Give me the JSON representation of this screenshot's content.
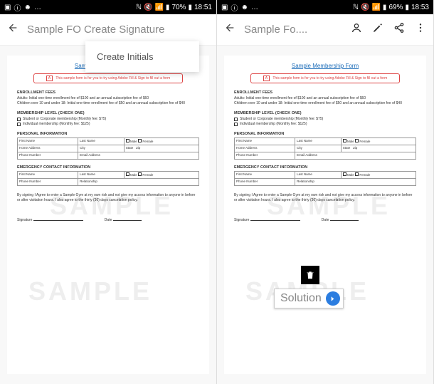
{
  "left": {
    "status": {
      "battery": "70%",
      "time": "18:51"
    },
    "app_title": "Sample FO Create Signature",
    "dropdown": {
      "item": "Create Initials"
    }
  },
  "right": {
    "status": {
      "battery": "69%",
      "time": "18:53"
    },
    "app_title": "Sample Fo....",
    "delete_label": "delete",
    "solution_label": "Solution"
  },
  "doc": {
    "title": "Sample Membership Form",
    "hint_badge": "A",
    "hint_text": "This sample form is for you to try using Adobe Fill & Sign to fill out a form",
    "enrollment_hdr": "ENROLLMENT FEES",
    "enrollment_line1": "Adults: Initial one-time enrollment fee of $100 and an annual subscription fee of $60",
    "enrollment_line2": "Children over 10 and under 18: Initial one-time enrollment fee of $50 and an annual subscription fee of $40",
    "level_hdr": "MEMBERSHIP LEVEL (CHECK ONE)",
    "level_opt1": "Student or Corporate membership (Monthly fee: $75)",
    "level_opt2": "Individual membership (Monthly fee: $125)",
    "personal_hdr": "PERSONAL INFORMATION",
    "fields": {
      "first_name": "First Name",
      "last_name": "Last Name",
      "male": "Male",
      "female": "Female",
      "home_address": "Home Address",
      "city": "City",
      "state": "State",
      "zip": "Zip",
      "phone": "Phone Number",
      "email": "Email Address",
      "relationship": "Relationship"
    },
    "emergency_hdr": "EMERGENCY CONTACT INFORMATION",
    "agreement": "By signing I Agree to enter a Sample Gym at my own risk and not give my access information to anyone in before or after visitation hours. I also agree to the thirty (30) days cancelation policy.",
    "signature": "Signature",
    "date": "Date",
    "watermark": "SAMPLE"
  }
}
